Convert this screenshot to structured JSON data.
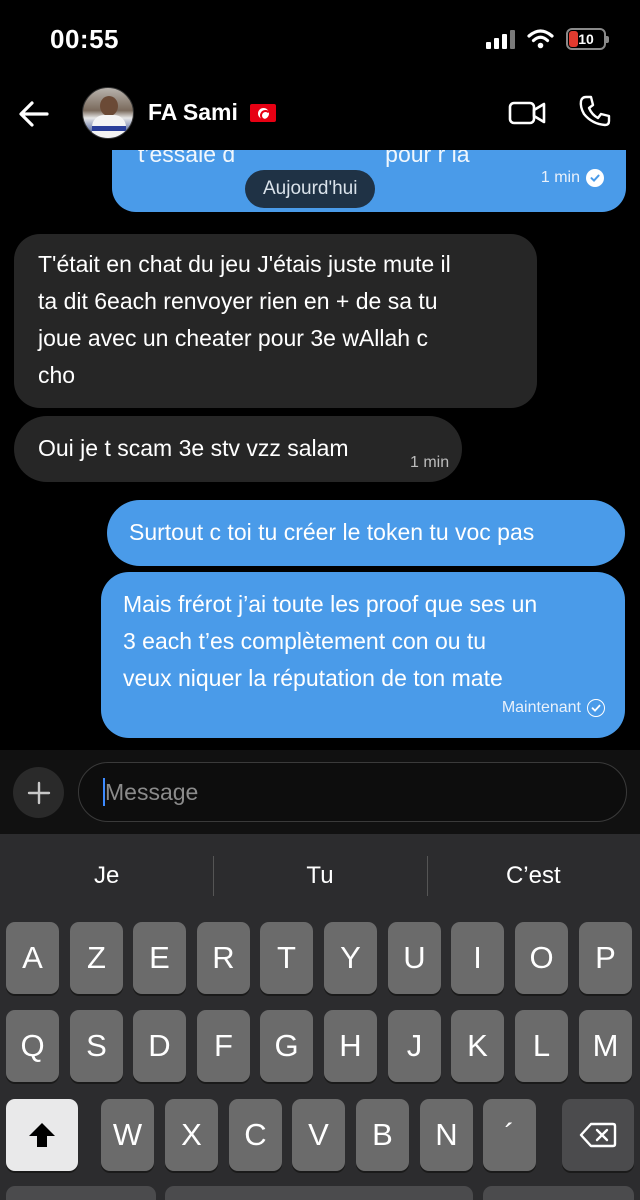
{
  "status_bar": {
    "time": "00:55",
    "battery": "10"
  },
  "header": {
    "contact_name": "FA Sami"
  },
  "chat": {
    "date_separator": "Aujourd'hui",
    "messages": [
      {
        "direction": "out",
        "lines": [
          "t’essaie d",
          "pour r la"
        ],
        "time": "1 min"
      },
      {
        "direction": "in",
        "lines": [
          "T'était en chat du jeu J'étais juste mute il",
          "ta dit 6each renvoyer rien en + de sa tu",
          "joue avec un cheater pour 3e wAllah c",
          "cho"
        ]
      },
      {
        "direction": "in",
        "lines": [
          "Oui je t scam 3e stv vzz salam"
        ],
        "time": "1 min"
      },
      {
        "direction": "out",
        "lines": [
          "Surtout c toi  tu créer le token tu voc pas"
        ]
      },
      {
        "direction": "out",
        "lines": [
          "Mais frérot j’ai toute les proof que ses un",
          "3 each t’es complètement con ou tu",
          "veux niquer la réputation de ton mate"
        ],
        "status": "Maintenant"
      }
    ]
  },
  "composer": {
    "placeholder": "Message"
  },
  "keyboard": {
    "suggestions": [
      "Je",
      "Tu",
      "C’est"
    ],
    "row1": [
      "A",
      "Z",
      "E",
      "R",
      "T",
      "Y",
      "U",
      "I",
      "O",
      "P"
    ],
    "row2": [
      "Q",
      "S",
      "D",
      "F",
      "G",
      "H",
      "J",
      "K",
      "L",
      "M"
    ],
    "row3": [
      "W",
      "X",
      "C",
      "V",
      "B",
      "N",
      "´"
    ]
  },
  "colors": {
    "outgoing_bubble": "#4a9be9",
    "incoming_bubble": "#262626",
    "background": "#000000"
  },
  "icons": [
    "back-arrow-icon",
    "video-camera-icon",
    "phone-icon",
    "plus-icon",
    "shift-icon",
    "backspace-icon",
    "wifi-icon",
    "signal-icon",
    "battery-icon"
  ]
}
